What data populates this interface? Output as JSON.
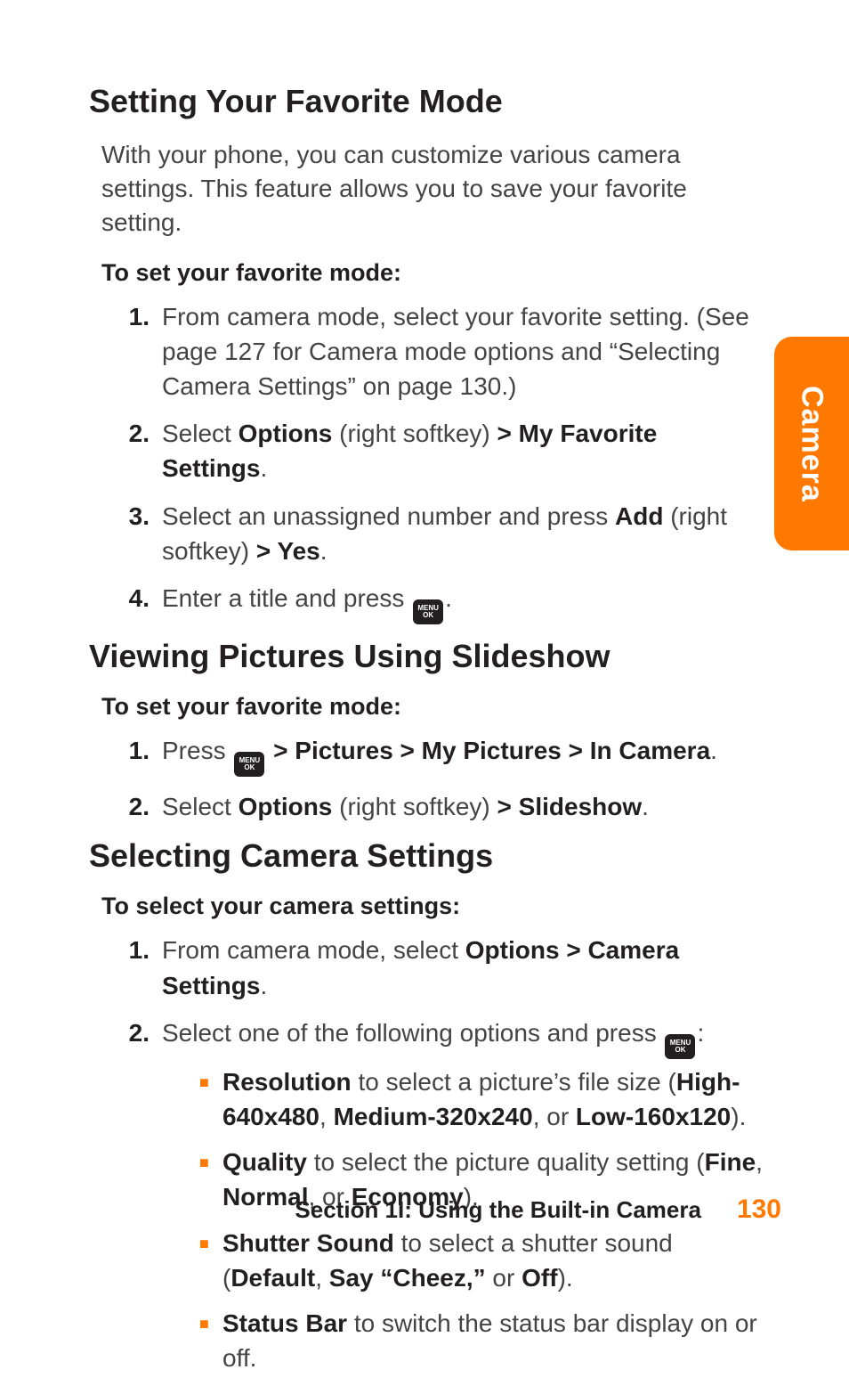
{
  "side_tab": "Camera",
  "sections": [
    {
      "title": "Setting Your Favorite Mode",
      "intro": "With your phone, you can customize various camera settings. This feature allows you to save your favorite setting.",
      "subhead": "To set your favorite mode:",
      "steps": [
        {
          "num": "1.",
          "pre": "From camera mode, select your favorite setting. (See page 127 for Camera mode options and “Selecting Camera Settings” on page 130.)"
        },
        {
          "num": "2.",
          "pre": "Select ",
          "b1": "Options",
          "mid": " (right softkey) ",
          "b2": "> My Favorite Settings",
          "post": "."
        },
        {
          "num": "3.",
          "pre": "Select an unassigned number and press ",
          "b1": "Add",
          "mid": " (right softkey) ",
          "b2": "> Yes",
          "post": "."
        },
        {
          "num": "4.",
          "pre": "Enter a title and press ",
          "key": true,
          "post": "."
        }
      ]
    },
    {
      "title": "Viewing Pictures Using Slideshow",
      "subhead": "To set your favorite mode:",
      "steps": [
        {
          "num": "1.",
          "pre": "Press ",
          "key": true,
          "mid": " ",
          "b1": "> Pictures > My Pictures > In Camera",
          "post": "."
        },
        {
          "num": "2.",
          "pre": "Select ",
          "b1": "Options",
          "mid": " (right softkey) ",
          "b2": "> Slideshow",
          "post": "."
        }
      ]
    },
    {
      "title": "Selecting Camera Settings",
      "subhead": "To select your camera settings:",
      "steps": [
        {
          "num": "1.",
          "pre": "From camera mode, select ",
          "b1": "Options > Camera Settings",
          "post": "."
        },
        {
          "num": "2.",
          "pre": "Select one of the following options and press ",
          "key": true,
          "post": ":",
          "subitems": [
            {
              "b1": "Resolution",
              "mid": " to select a picture’s file size (",
              "b2": "High-640x480",
              "c1": ", ",
              "b3": "Medium-320x240",
              "c2": ", or ",
              "b4": "Low-160x120",
              "post": ")."
            },
            {
              "b1": "Quality",
              "mid": " to select the picture quality setting (",
              "b2": "Fine",
              "c1": ", ",
              "b3": "Normal",
              "c2": ", or ",
              "b4": "Economy",
              "post": ")."
            },
            {
              "b1": "Shutter Sound",
              "mid": " to select a shutter sound (",
              "b2": "Default",
              "c1": ", ",
              "b3": "Say “Cheez,”",
              "c2": " or ",
              "b4": "Off",
              "post": ")."
            },
            {
              "b1": "Status Bar",
              "mid": " to switch the status bar display on or off."
            }
          ]
        }
      ]
    }
  ],
  "footer": {
    "section": "Section 1I: Using the Built-in Camera",
    "page": "130"
  },
  "menu_key": {
    "line1": "MENU",
    "line2": "OK"
  }
}
